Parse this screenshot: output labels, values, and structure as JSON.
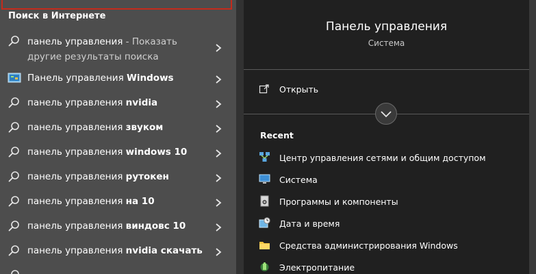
{
  "search": {
    "section_title": "Поиск в Интернете",
    "results": [
      {
        "prefix": "панель управления",
        "bold": "",
        "suffix": " - Показать другие результаты поиска",
        "icon": "search-icon"
      },
      {
        "prefix": "Панель управления ",
        "bold": "Windows",
        "suffix": "",
        "icon": "control-panel-icon"
      },
      {
        "prefix": "панель управления ",
        "bold": "nvidia",
        "suffix": "",
        "icon": "search-icon"
      },
      {
        "prefix": "панель управления ",
        "bold": "звуком",
        "suffix": "",
        "icon": "search-icon"
      },
      {
        "prefix": "панель управления ",
        "bold": "windows 10",
        "suffix": "",
        "icon": "search-icon"
      },
      {
        "prefix": "панель управления ",
        "bold": "рутокен",
        "suffix": "",
        "icon": "search-icon"
      },
      {
        "prefix": "панель управления ",
        "bold": "на 10",
        "suffix": "",
        "icon": "search-icon"
      },
      {
        "prefix": "панель управления ",
        "bold": "виндовс 10",
        "suffix": "",
        "icon": "search-icon"
      },
      {
        "prefix": "панель управления ",
        "bold": "nvidia скачать",
        "suffix": "",
        "icon": "search-icon"
      }
    ]
  },
  "preview": {
    "title": "Панель управления",
    "subtitle": "Система",
    "open_label": "Открыть",
    "recent_title": "Recent",
    "recent": [
      {
        "label": "Центр управления сетями и общим доступом",
        "icon": "network-center-icon"
      },
      {
        "label": "Система",
        "icon": "system-monitor-icon"
      },
      {
        "label": "Программы и компоненты",
        "icon": "programs-icon"
      },
      {
        "label": "Дата и время",
        "icon": "clock-icon"
      },
      {
        "label": "Средства администрирования Windows",
        "icon": "folder-icon"
      },
      {
        "label": "Электропитание",
        "icon": "power-icon"
      }
    ]
  },
  "colors": {
    "left_bg": "#4d4d4d",
    "right_bg": "#202020",
    "selection_border": "#c42b1c"
  }
}
